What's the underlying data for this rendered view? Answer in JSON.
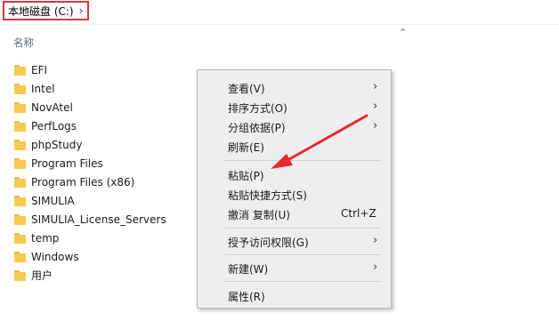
{
  "breadcrumb": {
    "drive_label": "本地磁盘 (C:)",
    "chevron_icon": "chevron-right-icon"
  },
  "list_header": {
    "name_column": "名称",
    "sort_icon": "chevron-up-icon"
  },
  "files": [
    {
      "name": "EFI"
    },
    {
      "name": "Intel"
    },
    {
      "name": "NovAtel"
    },
    {
      "name": "PerfLogs"
    },
    {
      "name": "phpStudy"
    },
    {
      "name": "Program Files"
    },
    {
      "name": "Program Files (x86)"
    },
    {
      "name": "SIMULIA"
    },
    {
      "name": "SIMULIA_License_Servers"
    },
    {
      "name": "temp"
    },
    {
      "name": "Windows"
    },
    {
      "name": "用户"
    }
  ],
  "context_menu": {
    "items": [
      {
        "label": "查看(V)",
        "has_submenu": true
      },
      {
        "label": "排序方式(O)",
        "has_submenu": true
      },
      {
        "label": "分组依据(P)",
        "has_submenu": true
      },
      {
        "label": "刷新(E)",
        "has_submenu": false
      },
      {
        "label": "粘贴(P)",
        "has_submenu": false
      },
      {
        "label": "粘贴快捷方式(S)",
        "has_submenu": false
      },
      {
        "label": "撤消 复制(U)",
        "shortcut": "Ctrl+Z",
        "has_submenu": false
      },
      {
        "label": "授予访问权限(G)",
        "has_submenu": true
      },
      {
        "label": "新建(W)",
        "has_submenu": true
      },
      {
        "label": "属性(R)",
        "has_submenu": false
      }
    ]
  },
  "colors": {
    "highlight_border": "#d9363e",
    "annotation_arrow": "#e8272e"
  }
}
